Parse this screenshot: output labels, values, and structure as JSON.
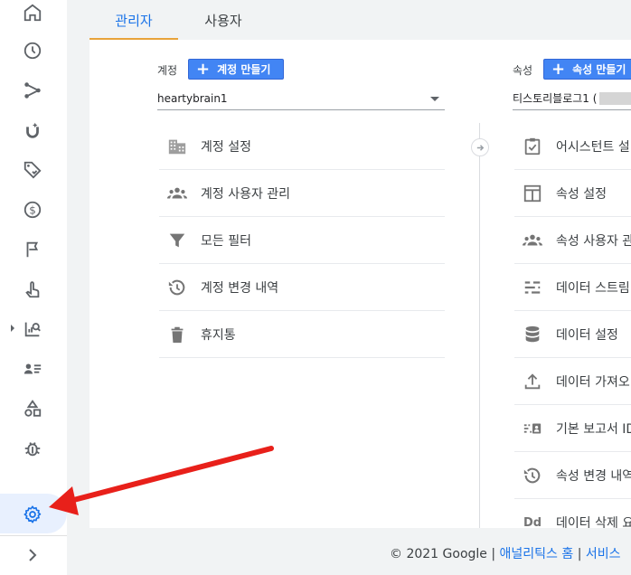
{
  "tabs": [
    {
      "label": "관리자",
      "active": true
    },
    {
      "label": "사용자",
      "active": false
    }
  ],
  "account": {
    "label": "계정",
    "create_label": "계정 만들기",
    "selected": "heartybrain1",
    "menu": [
      {
        "label": "계정 설정",
        "icon": "building-icon"
      },
      {
        "label": "계정 사용자 관리",
        "icon": "people-icon"
      },
      {
        "label": "모든 필터",
        "icon": "filter-icon"
      },
      {
        "label": "계정 변경 내역",
        "icon": "history-icon"
      },
      {
        "label": "휴지통",
        "icon": "trash-icon"
      }
    ]
  },
  "property": {
    "label": "속성",
    "create_label": "속성 만들기",
    "selected": "티스토리블로그1 (",
    "menu": [
      {
        "label": "어시스턴트 설",
        "icon": "checklist-icon"
      },
      {
        "label": "속성 설정",
        "icon": "layout-icon"
      },
      {
        "label": "속성 사용자 관",
        "icon": "people-icon"
      },
      {
        "label": "데이터 스트림",
        "icon": "streams-icon"
      },
      {
        "label": "데이터 설정",
        "icon": "database-icon"
      },
      {
        "label": "데이터 가져오",
        "icon": "upload-icon"
      },
      {
        "label": "기본 보고서 ID",
        "icon": "reporting-id-icon"
      },
      {
        "label": "속성 변경 내역",
        "icon": "history-icon"
      },
      {
        "label": "데이터 삭제 요",
        "icon": "dd-icon"
      }
    ]
  },
  "footer": {
    "copyright": "© 2021 Google",
    "sep1": " | ",
    "home_link": "애널리틱스 홈",
    "sep2": " | ",
    "service_link": "서비스"
  },
  "colors": {
    "accent": "#1a73e8",
    "button": "#4285f4",
    "tab_underline": "#e8a33a",
    "annotation": "#e8201a"
  }
}
